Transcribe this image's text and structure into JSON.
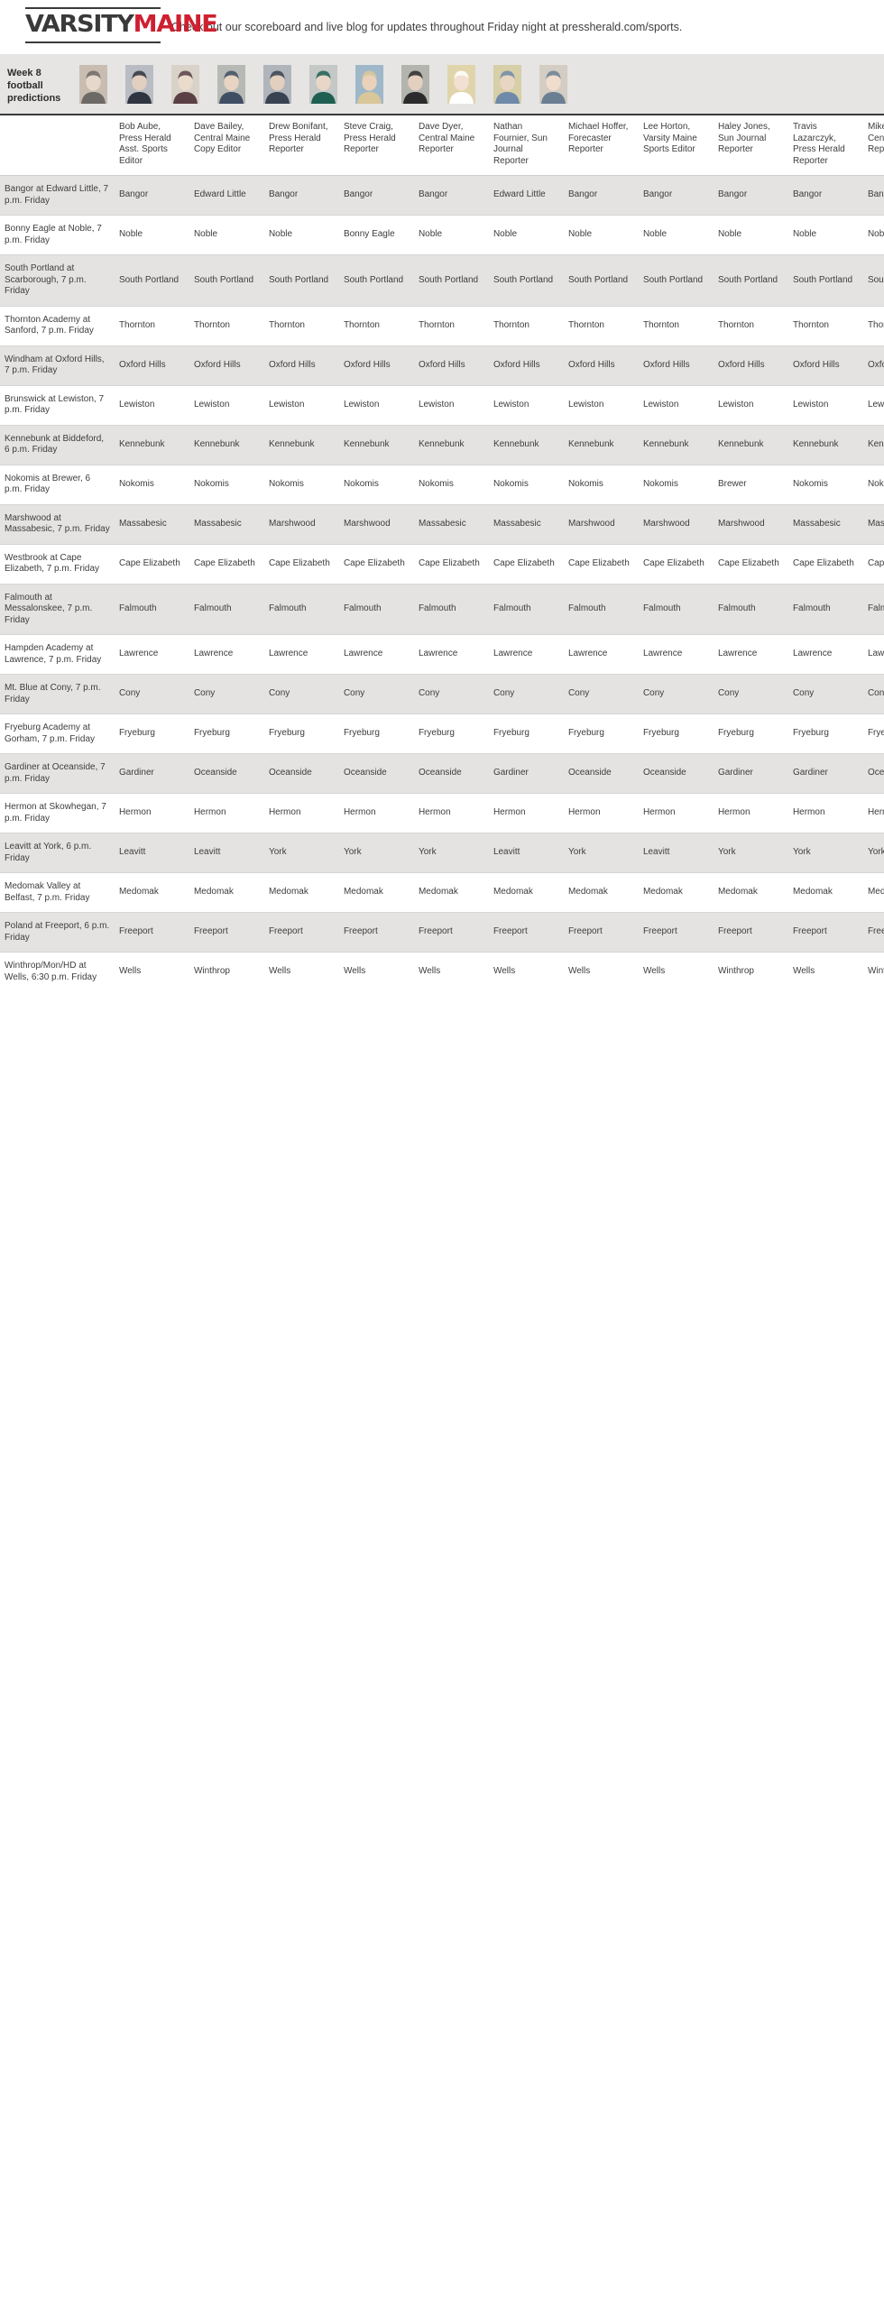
{
  "masthead": {
    "logo_first": "VARSITY",
    "logo_second": "MAINE",
    "tagline": "Check out our scoreboard and live blog for updates throughout Friday night at pressherald.com/sports."
  },
  "titlebar": {
    "label": "Week 8 football predictions"
  },
  "colors": {
    "brand_red": "#cf2030",
    "brand_dark": "#3a3a3a",
    "row_alt": "#e4e3e1",
    "header_band": "#e6e5e3"
  },
  "predictors": [
    {
      "name": "Bob Aube",
      "title": "Press Herald Asst. Sports Editor",
      "full": "Bob Aube, Press Herald Asst. Sports Editor"
    },
    {
      "name": "Dave Bailey",
      "title": "Central Maine Copy Editor",
      "full": "Dave Bailey, Central Maine Copy Editor"
    },
    {
      "name": "Drew Bonifant",
      "title": "Press Herald Reporter",
      "full": "Drew Bonifant, Press Herald Reporter"
    },
    {
      "name": "Steve Craig",
      "title": "Press Herald Reporter",
      "full": "Steve Craig, Press Herald Reporter"
    },
    {
      "name": "Dave Dyer",
      "title": "Central Maine Reporter",
      "full": "Dave Dyer, Central Maine Reporter"
    },
    {
      "name": "Nathan Fournier",
      "title": "Sun Journal Reporter",
      "full": "Nathan Fournier, Sun Journal Reporter"
    },
    {
      "name": "Michael Hoffer",
      "title": "Forecaster Reporter",
      "full": "Michael Hoffer, Forecaster Reporter"
    },
    {
      "name": "Lee Horton",
      "title": "Varsity Maine Sports Editor",
      "full": "Lee Horton, Varsity Maine Sports Editor"
    },
    {
      "name": "Haley Jones",
      "title": "Sun Journal Reporter",
      "full": "Haley Jones, Sun Journal Reporter"
    },
    {
      "name": "Travis Lazarczyk",
      "title": "Press Herald Reporter",
      "full": "Travis Lazarczyk, Press Herald Reporter"
    },
    {
      "name": "Mike Mandell",
      "title": "Central Maine Reporter",
      "full": "Mike Mandell, Central Maine Reporter"
    }
  ],
  "games": [
    {
      "matchup": "Bangor at Edward Little, 7 p.m. Friday",
      "picks": [
        "Bangor",
        "Edward Little",
        "Bangor",
        "Bangor",
        "Bangor",
        "Edward Little",
        "Bangor",
        "Bangor",
        "Bangor",
        "Bangor",
        "Bangor"
      ]
    },
    {
      "matchup": "Bonny Eagle at Noble, 7 p.m. Friday",
      "picks": [
        "Noble",
        "Noble",
        "Noble",
        "Bonny Eagle",
        "Noble",
        "Noble",
        "Noble",
        "Noble",
        "Noble",
        "Noble",
        "Noble"
      ]
    },
    {
      "matchup": "South Portland at Scarborough, 7 p.m. Friday",
      "picks": [
        "South Portland",
        "South Portland",
        "South Portland",
        "South Portland",
        "South Portland",
        "South Portland",
        "South Portland",
        "South Portland",
        "South Portland",
        "South Portland",
        "South Portland"
      ]
    },
    {
      "matchup": "Thornton Academy at Sanford, 7 p.m. Friday",
      "picks": [
        "Thornton",
        "Thornton",
        "Thornton",
        "Thornton",
        "Thornton",
        "Thornton",
        "Thornton",
        "Thornton",
        "Thornton",
        "Thornton",
        "Thornton"
      ]
    },
    {
      "matchup": "Windham at Oxford Hills, 7 p.m. Friday",
      "picks": [
        "Oxford Hills",
        "Oxford Hills",
        "Oxford Hills",
        "Oxford Hills",
        "Oxford Hills",
        "Oxford Hills",
        "Oxford Hills",
        "Oxford Hills",
        "Oxford Hills",
        "Oxford Hills",
        "Oxford Hills"
      ]
    },
    {
      "matchup": "Brunswick at Lewiston, 7 p.m. Friday",
      "picks": [
        "Lewiston",
        "Lewiston",
        "Lewiston",
        "Lewiston",
        "Lewiston",
        "Lewiston",
        "Lewiston",
        "Lewiston",
        "Lewiston",
        "Lewiston",
        "Lewiston"
      ]
    },
    {
      "matchup": "Kennebunk at Biddeford, 6 p.m. Friday",
      "picks": [
        "Kennebunk",
        "Kennebunk",
        "Kennebunk",
        "Kennebunk",
        "Kennebunk",
        "Kennebunk",
        "Kennebunk",
        "Kennebunk",
        "Kennebunk",
        "Kennebunk",
        "Kennebunk"
      ]
    },
    {
      "matchup": "Nokomis at Brewer, 6 p.m. Friday",
      "picks": [
        "Nokomis",
        "Nokomis",
        "Nokomis",
        "Nokomis",
        "Nokomis",
        "Nokomis",
        "Nokomis",
        "Nokomis",
        "Brewer",
        "Nokomis",
        "Nokomis"
      ]
    },
    {
      "matchup": "Marshwood at Massabesic, 7 p.m. Friday",
      "picks": [
        "Massabesic",
        "Massabesic",
        "Marshwood",
        "Marshwood",
        "Massabesic",
        "Massabesic",
        "Marshwood",
        "Marshwood",
        "Marshwood",
        "Massabesic",
        "Massabesic"
      ]
    },
    {
      "matchup": "Westbrook at Cape Elizabeth, 7 p.m. Friday",
      "picks": [
        "Cape Elizabeth",
        "Cape Elizabeth",
        "Cape Elizabeth",
        "Cape Elizabeth",
        "Cape Elizabeth",
        "Cape Elizabeth",
        "Cape Elizabeth",
        "Cape Elizabeth",
        "Cape Elizabeth",
        "Cape Elizabeth",
        "Cape Elizabeth"
      ]
    },
    {
      "matchup": "Falmouth at Messalonskee, 7 p.m. Friday",
      "picks": [
        "Falmouth",
        "Falmouth",
        "Falmouth",
        "Falmouth",
        "Falmouth",
        "Falmouth",
        "Falmouth",
        "Falmouth",
        "Falmouth",
        "Falmouth",
        "Falmouth"
      ]
    },
    {
      "matchup": "Hampden Academy at Lawrence, 7 p.m. Friday",
      "picks": [
        "Lawrence",
        "Lawrence",
        "Lawrence",
        "Lawrence",
        "Lawrence",
        "Lawrence",
        "Lawrence",
        "Lawrence",
        "Lawrence",
        "Lawrence",
        "Lawrence"
      ]
    },
    {
      "matchup": "Mt. Blue at Cony, 7 p.m. Friday",
      "picks": [
        "Cony",
        "Cony",
        "Cony",
        "Cony",
        "Cony",
        "Cony",
        "Cony",
        "Cony",
        "Cony",
        "Cony",
        "Cony"
      ]
    },
    {
      "matchup": "Fryeburg Academy at Gorham, 7 p.m. Friday",
      "picks": [
        "Fryeburg",
        "Fryeburg",
        "Fryeburg",
        "Fryeburg",
        "Fryeburg",
        "Fryeburg",
        "Fryeburg",
        "Fryeburg",
        "Fryeburg",
        "Fryeburg",
        "Fryeburg"
      ]
    },
    {
      "matchup": "Gardiner at Oceanside, 7 p.m. Friday",
      "picks": [
        "Gardiner",
        "Oceanside",
        "Oceanside",
        "Oceanside",
        "Oceanside",
        "Gardiner",
        "Oceanside",
        "Oceanside",
        "Gardiner",
        "Gardiner",
        "Oceanside"
      ]
    },
    {
      "matchup": "Hermon at Skowhegan, 7 p.m. Friday",
      "picks": [
        "Hermon",
        "Hermon",
        "Hermon",
        "Hermon",
        "Hermon",
        "Hermon",
        "Hermon",
        "Hermon",
        "Hermon",
        "Hermon",
        "Hermon"
      ]
    },
    {
      "matchup": "Leavitt at York, 6 p.m. Friday",
      "picks": [
        "Leavitt",
        "Leavitt",
        "York",
        "York",
        "York",
        "Leavitt",
        "York",
        "Leavitt",
        "York",
        "York",
        "York"
      ]
    },
    {
      "matchup": "Medomak Valley at Belfast, 7 p.m. Friday",
      "picks": [
        "Medomak",
        "Medomak",
        "Medomak",
        "Medomak",
        "Medomak",
        "Medomak",
        "Medomak",
        "Medomak",
        "Medomak",
        "Medomak",
        "Medomak"
      ]
    },
    {
      "matchup": "Poland at Freeport, 6 p.m. Friday",
      "picks": [
        "Freeport",
        "Freeport",
        "Freeport",
        "Freeport",
        "Freeport",
        "Freeport",
        "Freeport",
        "Freeport",
        "Freeport",
        "Freeport",
        "Freeport"
      ]
    },
    {
      "matchup": "Winthrop/Mon/HD at Wells, 6:30 p.m. Friday",
      "picks": [
        "Wells",
        "Winthrop",
        "Wells",
        "Wells",
        "Wells",
        "Wells",
        "Wells",
        "Wells",
        "Winthrop",
        "Wells",
        "Winthrop"
      ]
    }
  ]
}
